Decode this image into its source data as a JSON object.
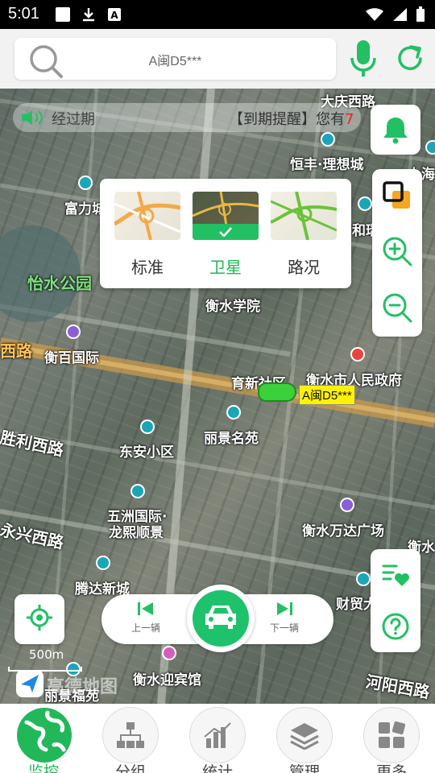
{
  "status_bar": {
    "time": "5:01"
  },
  "search": {
    "value": "A闽D5***"
  },
  "notice": {
    "left_text": "经过期",
    "right_text": "【到期提醒】您有",
    "count": "7"
  },
  "map": {
    "pois": [
      {
        "text": "大庆西路",
        "cls": "poi dark"
      },
      {
        "text": "恒丰·理想城",
        "cls": "poi"
      },
      {
        "text": "上海",
        "cls": "poi"
      },
      {
        "text": "富力城",
        "cls": "poi"
      },
      {
        "text": "和瑞景",
        "cls": "poi"
      },
      {
        "text": "怡水公园",
        "cls": "poi lg green"
      },
      {
        "text": "衡水学院",
        "cls": "poi"
      },
      {
        "text": "西路",
        "cls": "poi lg orange"
      },
      {
        "text": "衡百国际",
        "cls": "poi"
      },
      {
        "text": "育新社区",
        "cls": "poi"
      },
      {
        "text": "衡水市人民政府",
        "cls": "poi"
      },
      {
        "text": "丽景名苑",
        "cls": "poi"
      },
      {
        "text": "胜利西路",
        "cls": "poi lg"
      },
      {
        "text": "东安小区",
        "cls": "poi"
      },
      {
        "text": "五洲国际·",
        "cls": "poi"
      },
      {
        "text": "龙熙顺景",
        "cls": "poi"
      },
      {
        "text": "衡水万达广场",
        "cls": "poi"
      },
      {
        "text": "永兴西路",
        "cls": "poi lg"
      },
      {
        "text": "衡水",
        "cls": "poi"
      },
      {
        "text": "腾达新城",
        "cls": "poi"
      },
      {
        "text": "财贸大",
        "cls": "poi"
      },
      {
        "text": "衡水迎宾馆",
        "cls": "poi"
      },
      {
        "text": "丽景福苑",
        "cls": "poi"
      },
      {
        "text": "河阳西路",
        "cls": "poi lg"
      }
    ],
    "vehicle_tag": "A闽D5***",
    "scale_label": "500m",
    "logo_text": "高德地图"
  },
  "layer_popup": {
    "options": [
      {
        "label": "标准",
        "selected": false
      },
      {
        "label": "卫星",
        "selected": true
      },
      {
        "label": "路况",
        "selected": false
      }
    ]
  },
  "switcher": {
    "prev_label": "上一辆",
    "next_label": "下一辆"
  },
  "tabs": [
    {
      "label": "监控",
      "icon": "globe-icon",
      "active": true
    },
    {
      "label": "分组",
      "icon": "org-chart-icon",
      "active": false
    },
    {
      "label": "统计",
      "icon": "bar-chart-icon",
      "active": false
    },
    {
      "label": "管理",
      "icon": "layers-icon",
      "active": false
    },
    {
      "label": "更多",
      "icon": "grid-icon",
      "active": false
    }
  ],
  "colors": {
    "accent": "#1db954",
    "notice_count": "#e22222",
    "vehicle_tag_bg": "#fff200"
  }
}
